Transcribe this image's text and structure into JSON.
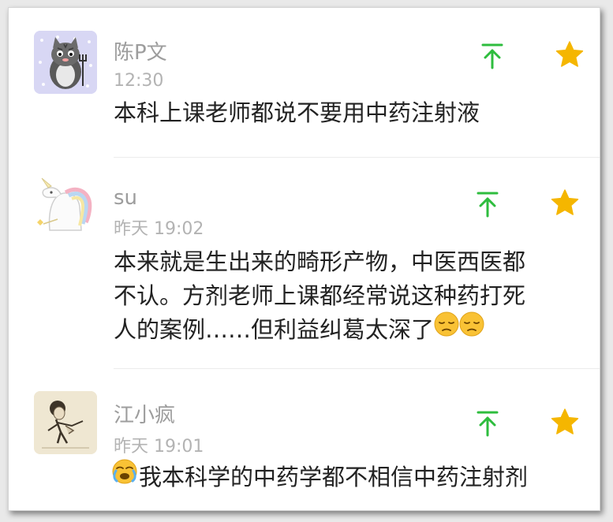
{
  "colors": {
    "upvote": "#2ebd3e",
    "star": "#f5b600",
    "name": "#9d9d9d",
    "time": "#b3b3b3",
    "text": "#222222"
  },
  "comments": [
    {
      "name": "陈P文",
      "time": "12:30",
      "lines": [
        "本科上课老师都说不要用中药注射液"
      ],
      "avatar": "cat-avatar",
      "actions": [
        "upvote-icon",
        "star-icon"
      ]
    },
    {
      "name": "su",
      "time": "昨天 19:02",
      "lines": [
        "本来就是生出来的畸形产物，中医西医都",
        "不认。方剂老师上课都经常说这种药打死",
        "人的案例……但利益纠葛太深了"
      ],
      "trailing_emoji": [
        "pensive-face-emoji",
        "pensive-face-emoji"
      ],
      "avatar": "unicorn-avatar",
      "actions": [
        "upvote-icon",
        "star-icon"
      ]
    },
    {
      "name": "江小疯",
      "time": "昨天 19:01",
      "lines": [
        "我本科学的中药学都不相信中药注射剂"
      ],
      "leading_emoji": "crying-face-emoji",
      "avatar": "sketch-person-avatar",
      "actions": [
        "upvote-icon",
        "star-icon"
      ]
    }
  ]
}
